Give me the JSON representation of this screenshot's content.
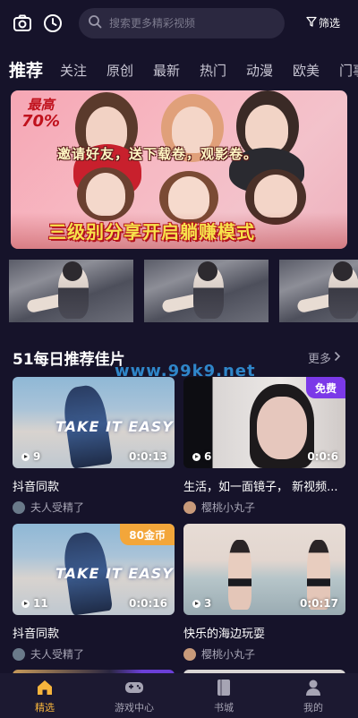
{
  "header": {
    "camera_icon": "camera-icon",
    "history_icon": "clock-icon",
    "search_placeholder": "搜索更多精彩视频",
    "filter_label": "筛选"
  },
  "tabs": [
    "推荐",
    "关注",
    "原创",
    "最新",
    "热门",
    "动漫",
    "欧美",
    "门事"
  ],
  "banner": {
    "badge_line1": "最高",
    "badge_line2": "70%",
    "middle_text": "邀请好友，送下载卷，观影卷。",
    "bottom_text": "三级别分享开启躺赚模式"
  },
  "section": {
    "title": "51每日推荐佳片",
    "more_label": "更多",
    "watermark": "www.99k9.net"
  },
  "cards": [
    {
      "title": "抖音同款",
      "author": "夫人受精了",
      "views": "9",
      "duration": "0:0:13",
      "tag": "",
      "overlay_text": "TAKE IT EASY"
    },
    {
      "title": "生活，如一面镜子， 新视频...",
      "author": "樱桃小丸子",
      "views": "6",
      "duration": "0:0:6",
      "tag": "免费",
      "overlay_text": ""
    },
    {
      "title": "抖音同款",
      "author": "夫人受精了",
      "views": "11",
      "duration": "0:0:16",
      "tag": "80金币",
      "overlay_text": "TAKE IT EASY"
    },
    {
      "title": "快乐的海边玩耍",
      "author": "樱桃小丸子",
      "views": "3",
      "duration": "0:0:17",
      "tag": "",
      "overlay_text": ""
    }
  ],
  "bottom_nav": [
    {
      "label": "精选",
      "icon": "home-icon",
      "active": true
    },
    {
      "label": "游戏中心",
      "icon": "gamepad-icon",
      "active": false
    },
    {
      "label": "书城",
      "icon": "book-icon",
      "active": false
    },
    {
      "label": "我的",
      "icon": "user-icon",
      "active": false
    }
  ],
  "colors": {
    "background": "#16132a",
    "active_nav": "#f6b43c",
    "free_tag": "#7b39e8",
    "coin_tag": "#f3a63a",
    "watermark": "#2f86c9"
  }
}
